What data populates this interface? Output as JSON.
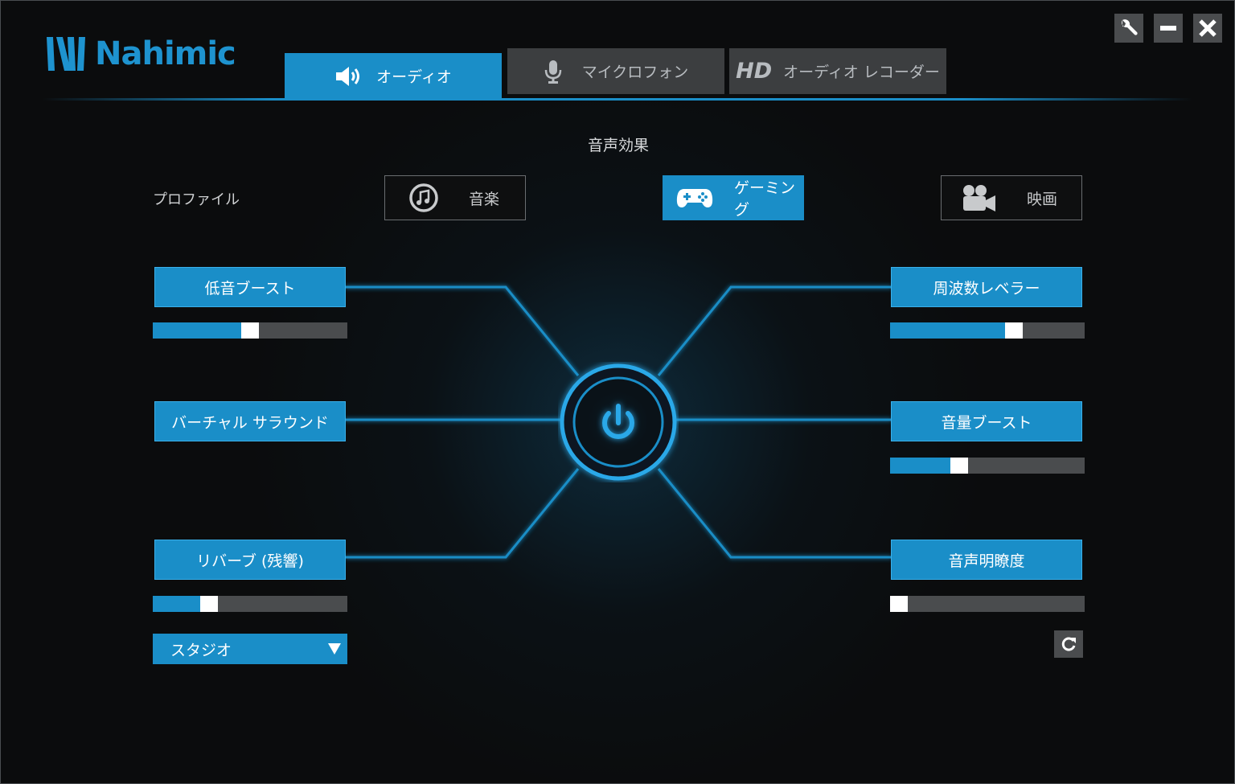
{
  "app": {
    "logo_text": "Nahimic"
  },
  "window_controls": {
    "settings": "wrench-icon",
    "minimize": "minimize-icon",
    "close": "close-icon"
  },
  "tabs": [
    {
      "label": "オーディオ",
      "icon": "speaker-icon",
      "active": true
    },
    {
      "label": "マイクロフォン",
      "icon": "microphone-icon",
      "active": false
    },
    {
      "prefix": "HD",
      "label": "オーディオ レコーダー",
      "active": false
    }
  ],
  "section_title": "音声効果",
  "profile": {
    "label": "プロファイル",
    "options": [
      {
        "label": "音楽",
        "icon": "music-note-icon",
        "selected": false
      },
      {
        "label": "ゲーミング",
        "icon": "gamepad-icon",
        "selected": true
      },
      {
        "label": "映画",
        "icon": "movie-camera-icon",
        "selected": false
      }
    ]
  },
  "effects": {
    "bass_boost": {
      "label": "低音ブースト",
      "level": 0.5
    },
    "virtual_surround": {
      "label": "バーチャル サラウンド"
    },
    "reverb": {
      "label": "リバーブ (残響)",
      "level": 0.27,
      "preset": "スタジオ"
    },
    "frequency_leveler": {
      "label": "周波数レベラー",
      "level": 0.65
    },
    "volume_boost": {
      "label": "音量ブースト",
      "level": 0.34
    },
    "voice_clarity": {
      "label": "音声明瞭度",
      "level": 0.0
    }
  },
  "colors": {
    "accent": "#1a8ec8",
    "track": "#4a4c4e",
    "background": "#0b0c0d"
  }
}
